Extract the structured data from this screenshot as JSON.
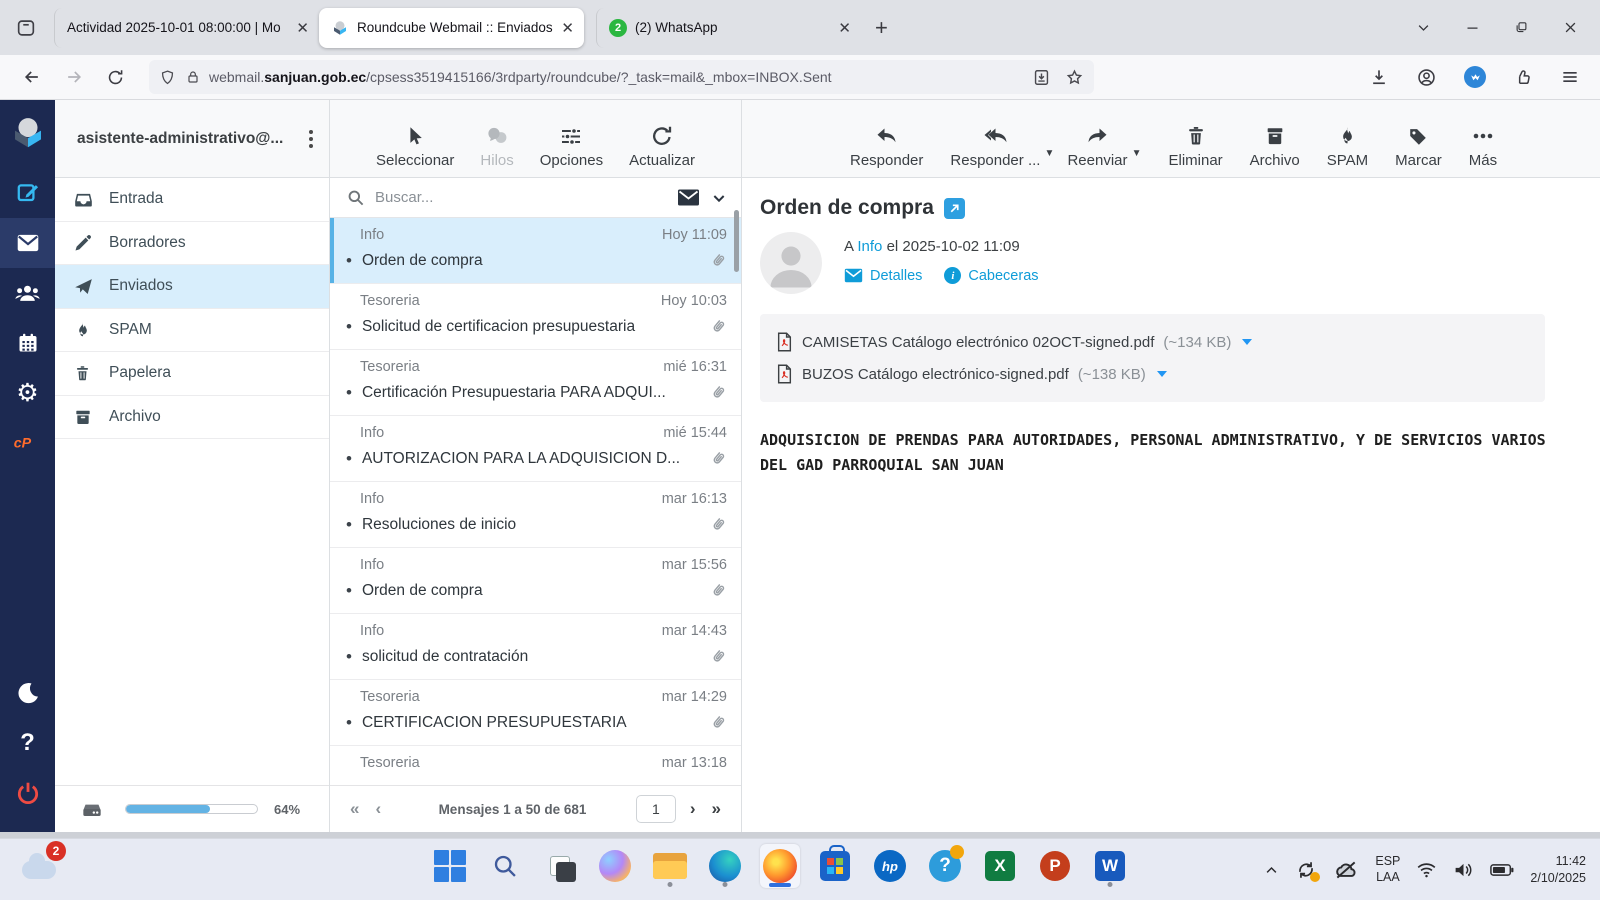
{
  "browser": {
    "tabs": [
      {
        "title": "Actividad 2025-10-01 08:00:00 | Mo"
      },
      {
        "title": "Roundcube Webmail :: Enviados"
      },
      {
        "title": "(2) WhatsApp",
        "badge": "2"
      }
    ],
    "close_glyph": "✕",
    "new_tab_glyph": "+",
    "url": {
      "prefix": "webmail.",
      "domain": "sanjuan.gob.ec",
      "path": "/cpsess3519415166/3rdparty/roundcube/?_task=mail&_mbox=INBOX.Sent"
    }
  },
  "webmail": {
    "account": "asistente-administrativo@...",
    "folders": [
      {
        "label": "Entrada"
      },
      {
        "label": "Borradores"
      },
      {
        "label": "Enviados"
      },
      {
        "label": "SPAM"
      },
      {
        "label": "Papelera"
      },
      {
        "label": "Archivo"
      }
    ],
    "quota_percent": "64%",
    "list_toolbar": {
      "select": "Seleccionar",
      "threads": "Hilos",
      "options": "Opciones",
      "refresh": "Actualizar"
    },
    "search": {
      "placeholder": "Buscar..."
    },
    "messages": [
      {
        "sender": "Info",
        "date": "Hoy 11:09",
        "subject": "Orden de compra"
      },
      {
        "sender": "Tesoreria",
        "date": "Hoy 10:03",
        "subject": "Solicitud de certificacion presupuestaria"
      },
      {
        "sender": "Tesoreria",
        "date": "mié 16:31",
        "subject": "Certificación Presupuestaria PARA ADQUI..."
      },
      {
        "sender": "Info",
        "date": "mié 15:44",
        "subject": "AUTORIZACION PARA LA ADQUISICION D..."
      },
      {
        "sender": "Info",
        "date": "mar 16:13",
        "subject": "Resoluciones de inicio"
      },
      {
        "sender": "Info",
        "date": "mar 15:56",
        "subject": "Orden de compra"
      },
      {
        "sender": "Info",
        "date": "mar 14:43",
        "subject": "solicitud de contratación"
      },
      {
        "sender": "Tesoreria",
        "date": "mar 14:29",
        "subject": "CERTIFICACION PRESUPUESTARIA"
      },
      {
        "sender": "Tesoreria",
        "date": "mar 13:18",
        "subject": ""
      }
    ],
    "pagination": {
      "summary": "Mensajes 1 a 50 de 681",
      "page": "1"
    },
    "message_toolbar": {
      "reply": "Responder",
      "reply_all": "Responder ...",
      "forward": "Reenviar",
      "delete": "Eliminar",
      "archive": "Archivo",
      "spam": "SPAM",
      "mark": "Marcar",
      "more": "Más"
    },
    "message": {
      "subject": "Orden de compra",
      "to_prefix": "A",
      "to_name": "Info",
      "date_text": "el 2025-10-02 11:09",
      "details_label": "Detalles",
      "headers_label": "Cabeceras",
      "attachments": [
        {
          "name": "CAMISETAS Catálogo electrónico 02OCT-signed.pdf",
          "size": "(~134 KB)"
        },
        {
          "name": "BUZOS Catálogo electrónico-signed.pdf",
          "size": "(~138 KB)"
        }
      ],
      "body": "ADQUISICION DE PRENDAS PARA AUTORIDADES, PERSONAL ADMINISTRATIVO, Y DE SERVICIOS VARIOS DEL GAD PARROQUIAL SAN JUAN"
    }
  },
  "taskbar": {
    "badge_count": "2",
    "tray": {
      "lang_top": "ESP",
      "lang_bottom": "LAA",
      "time": "11:42",
      "date": "2/10/2025"
    }
  },
  "colors": {
    "accent_blue": "#0f9cd8",
    "rail_navy": "#1c2951",
    "selected_row": "#d9eefc",
    "quota_fill": "#63b3e4",
    "cpanel_orange": "#ff6c2c"
  }
}
